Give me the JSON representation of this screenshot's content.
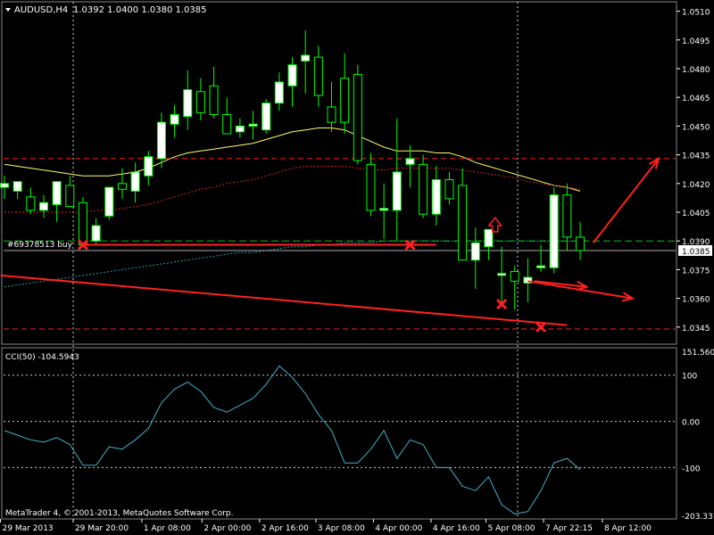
{
  "window": {
    "symbol_title": "AUDUSD,H4",
    "ohlc": "1.0392 1.0400 1.0380 1.0385",
    "footer": "MetaTrader 4, © 2001-2013, MetaQuotes Software Corp."
  },
  "main_chart": {
    "price_levels": [
      "1.0510",
      "1.0495",
      "1.0480",
      "1.0465",
      "1.0450",
      "1.0435",
      "1.0420",
      "1.0405",
      "1.0390",
      "1.0375",
      "1.0360",
      "1.0345"
    ],
    "current_price": "1.0385",
    "order_label": "#69378513 buy",
    "order_price": 1.0388,
    "order_line_price": 1.039,
    "price_range": [
      1.0337,
      1.0514
    ]
  },
  "indicator": {
    "label": "CCI(50) -104.5943",
    "levels": [
      "151.5601",
      "100",
      "0.00",
      "-100",
      "-203.337"
    ],
    "value_range": [
      -203.337,
      151.5601
    ]
  },
  "time_axis": {
    "labels": [
      "29 Mar 2013",
      "29 Mar 20:00",
      "1 Apr 08:00",
      "2 Apr 00:00",
      "2 Apr 16:00",
      "3 Apr 08:00",
      "4 Apr 00:00",
      "4 Apr 16:00",
      "5 Apr 08:00",
      "7 Apr 22:15",
      "8 Apr 12:00"
    ]
  },
  "colors": {
    "background": "#000000",
    "bull_body": "#ffffff",
    "bear_body": "#000000",
    "wick": "#00ff00",
    "ma_slow": "#ffff66",
    "ma_mid": "#cc2222",
    "ma_long": "#20a0a0",
    "cci_line": "#40b0c8",
    "annotation": "#ff2020",
    "grid": "#cccccc",
    "text": "#ffffff"
  },
  "chart_data": [
    {
      "type": "candlestick",
      "title": "AUDUSD,H4",
      "candles": [
        {
          "o": 1.0418,
          "h": 1.0424,
          "l": 1.0412,
          "c": 1.042
        },
        {
          "o": 1.0416,
          "h": 1.042,
          "l": 1.0412,
          "c": 1.0421
        },
        {
          "o": 1.0413,
          "h": 1.0418,
          "l": 1.0404,
          "c": 1.0406
        },
        {
          "o": 1.0406,
          "h": 1.0414,
          "l": 1.0402,
          "c": 1.041
        },
        {
          "o": 1.0409,
          "h": 1.0418,
          "l": 1.04,
          "c": 1.0421
        },
        {
          "o": 1.0419,
          "h": 1.0424,
          "l": 1.0409,
          "c": 1.0408
        },
        {
          "o": 1.041,
          "h": 1.0413,
          "l": 1.0388,
          "c": 1.0388
        },
        {
          "o": 1.039,
          "h": 1.0402,
          "l": 1.0388,
          "c": 1.0398
        },
        {
          "o": 1.0403,
          "h": 1.0414,
          "l": 1.0401,
          "c": 1.0418
        },
        {
          "o": 1.042,
          "h": 1.0428,
          "l": 1.0412,
          "c": 1.0417
        },
        {
          "o": 1.0416,
          "h": 1.0431,
          "l": 1.041,
          "c": 1.0426
        },
        {
          "o": 1.0424,
          "h": 1.0437,
          "l": 1.0419,
          "c": 1.0434
        },
        {
          "o": 1.0433,
          "h": 1.0457,
          "l": 1.0428,
          "c": 1.0452
        },
        {
          "o": 1.0451,
          "h": 1.0461,
          "l": 1.0444,
          "c": 1.0456
        },
        {
          "o": 1.0455,
          "h": 1.0479,
          "l": 1.0448,
          "c": 1.0469
        },
        {
          "o": 1.0468,
          "h": 1.0475,
          "l": 1.0453,
          "c": 1.0457
        },
        {
          "o": 1.0471,
          "h": 1.0481,
          "l": 1.0454,
          "c": 1.0456
        },
        {
          "o": 1.0456,
          "h": 1.0465,
          "l": 1.0448,
          "c": 1.0446
        },
        {
          "o": 1.0447,
          "h": 1.0454,
          "l": 1.0444,
          "c": 1.045
        },
        {
          "o": 1.045,
          "h": 1.0458,
          "l": 1.0443,
          "c": 1.0451
        },
        {
          "o": 1.0448,
          "h": 1.0464,
          "l": 1.0446,
          "c": 1.0462
        },
        {
          "o": 1.0462,
          "h": 1.0478,
          "l": 1.0458,
          "c": 1.0473
        },
        {
          "o": 1.0471,
          "h": 1.0486,
          "l": 1.046,
          "c": 1.0482
        },
        {
          "o": 1.0484,
          "h": 1.05,
          "l": 1.0467,
          "c": 1.0487
        },
        {
          "o": 1.0486,
          "h": 1.0492,
          "l": 1.046,
          "c": 1.0466
        },
        {
          "o": 1.046,
          "h": 1.0473,
          "l": 1.0447,
          "c": 1.0452
        },
        {
          "o": 1.0475,
          "h": 1.0488,
          "l": 1.0446,
          "c": 1.0452
        },
        {
          "o": 1.0477,
          "h": 1.0482,
          "l": 1.043,
          "c": 1.0432
        },
        {
          "o": 1.043,
          "h": 1.0436,
          "l": 1.0403,
          "c": 1.0406
        },
        {
          "o": 1.0406,
          "h": 1.042,
          "l": 1.0391,
          "c": 1.0407
        },
        {
          "o": 1.0406,
          "h": 1.0454,
          "l": 1.039,
          "c": 1.0426
        },
        {
          "o": 1.043,
          "h": 1.044,
          "l": 1.0418,
          "c": 1.0433
        },
        {
          "o": 1.043,
          "h": 1.0435,
          "l": 1.0402,
          "c": 1.0404
        },
        {
          "o": 1.0404,
          "h": 1.0429,
          "l": 1.0398,
          "c": 1.0422
        },
        {
          "o": 1.0422,
          "h": 1.0426,
          "l": 1.0409,
          "c": 1.0412
        },
        {
          "o": 1.0419,
          "h": 1.0428,
          "l": 1.038,
          "c": 1.038
        },
        {
          "o": 1.038,
          "h": 1.0397,
          "l": 1.0365,
          "c": 1.0389
        },
        {
          "o": 1.0387,
          "h": 1.0395,
          "l": 1.038,
          "c": 1.0396
        },
        {
          "o": 1.0372,
          "h": 1.0387,
          "l": 1.0356,
          "c": 1.0373
        },
        {
          "o": 1.0374,
          "h": 1.0377,
          "l": 1.0354,
          "c": 1.0369
        },
        {
          "o": 1.0368,
          "h": 1.0381,
          "l": 1.0358,
          "c": 1.0371
        },
        {
          "o": 1.0376,
          "h": 1.0388,
          "l": 1.0374,
          "c": 1.0377
        },
        {
          "o": 1.0376,
          "h": 1.0418,
          "l": 1.0373,
          "c": 1.0414
        },
        {
          "o": 1.0414,
          "h": 1.042,
          "l": 1.0385,
          "c": 1.0392
        },
        {
          "o": 1.0392,
          "h": 1.04,
          "l": 1.038,
          "c": 1.0385
        }
      ],
      "ma_series": [
        {
          "color": "#ffff66",
          "values": [
            1.043,
            1.0429,
            1.0428,
            1.0427,
            1.0426,
            1.0425,
            1.0424,
            1.0424,
            1.0424,
            1.0425,
            1.0426,
            1.0428,
            1.0431,
            1.0434,
            1.0436,
            1.0437,
            1.0438,
            1.0439,
            1.044,
            1.0441,
            1.0443,
            1.0445,
            1.0447,
            1.0448,
            1.0449,
            1.0449,
            1.0448,
            1.0445,
            1.0442,
            1.0439,
            1.0437,
            1.0437,
            1.0437,
            1.0436,
            1.0436,
            1.0434,
            1.0431,
            1.0429,
            1.0427,
            1.0425,
            1.0423,
            1.0421,
            1.0419,
            1.0418,
            1.0416
          ]
        },
        {
          "color": "#cc2222",
          "values": [
            1.0405,
            1.0405,
            1.0405,
            1.0405,
            1.0405,
            1.0405,
            1.0405,
            1.0406,
            1.0406,
            1.0407,
            1.0408,
            1.0409,
            1.0411,
            1.0413,
            1.0415,
            1.0417,
            1.0418,
            1.042,
            1.0421,
            1.0422,
            1.0424,
            1.0426,
            1.0428,
            1.0429,
            1.0429,
            1.0429,
            1.0429,
            1.0428,
            1.0427,
            1.0427,
            1.0428,
            1.0428,
            1.0428,
            1.0428,
            1.0428,
            1.0427,
            1.0426,
            1.0425,
            1.0424,
            1.0423,
            1.0421,
            1.042,
            1.0419,
            1.0418,
            1.0417
          ]
        },
        {
          "color": "#20a0a0",
          "values": [
            1.0366,
            1.0367,
            1.0368,
            1.0369,
            1.037,
            1.0371,
            1.0372,
            1.0373,
            1.0374,
            1.0375,
            1.0376,
            1.0377,
            1.0378,
            1.0379,
            1.038,
            1.0381,
            1.0382,
            1.0383,
            1.0384,
            1.0384,
            1.0385,
            1.0386,
            1.0387,
            1.0387,
            1.0388,
            1.0388,
            1.0389,
            1.0389,
            1.0389,
            1.039,
            1.039,
            1.039,
            1.039,
            1.039,
            1.039,
            1.039,
            1.039,
            1.039,
            1.039,
            1.039,
            1.039,
            1.039,
            1.039,
            1.039,
            1.039
          ]
        }
      ],
      "ylim": [
        1.0337,
        1.0514
      ]
    },
    {
      "type": "line",
      "title": "CCI(50) -104.5943",
      "values": [
        -20,
        -30,
        -40,
        -45,
        -35,
        -50,
        -95,
        -95,
        -55,
        -60,
        -40,
        -15,
        40,
        70,
        85,
        65,
        30,
        20,
        35,
        50,
        80,
        120,
        95,
        60,
        15,
        -20,
        -90,
        -90,
        -60,
        -20,
        -80,
        -40,
        -50,
        -100,
        -100,
        -140,
        -150,
        -120,
        -180,
        -200,
        -195,
        -150,
        -90,
        -80,
        -104.5943
      ],
      "ylim": [
        -203.337,
        151.5601
      ],
      "levels": [
        100,
        0,
        -100
      ]
    }
  ],
  "annotations": {
    "crosses": [
      {
        "i": 6,
        "price": 1.0388
      },
      {
        "i": 31,
        "price": 1.0388
      },
      {
        "i": 38,
        "price": 1.0357
      },
      {
        "i": 41,
        "price": 1.0345
      }
    ],
    "trendlines": [
      {
        "from": {
          "i": -0.3,
          "price": 1.0372
        },
        "to": {
          "i": 43,
          "price": 1.0346
        }
      },
      {
        "from": {
          "i": 6,
          "price": 1.0388
        },
        "to": {
          "i": 33,
          "price": 1.0388
        }
      }
    ],
    "arrows": [
      {
        "from": {
          "i": 40,
          "price": 1.0369
        },
        "to": {
          "i": 48,
          "price": 1.036
        }
      },
      {
        "from": {
          "i": 40.5,
          "price": 1.0369
        },
        "to": {
          "i": 44.5,
          "price": 1.0366
        }
      },
      {
        "from": {
          "i": 45,
          "price": 1.0389
        },
        "to": {
          "i": 50,
          "price": 1.0433
        }
      }
    ],
    "up_arrow": {
      "i": 37.5,
      "price": 1.0398
    },
    "dashed_levels": [
      1.0433,
      1.0344
    ]
  }
}
